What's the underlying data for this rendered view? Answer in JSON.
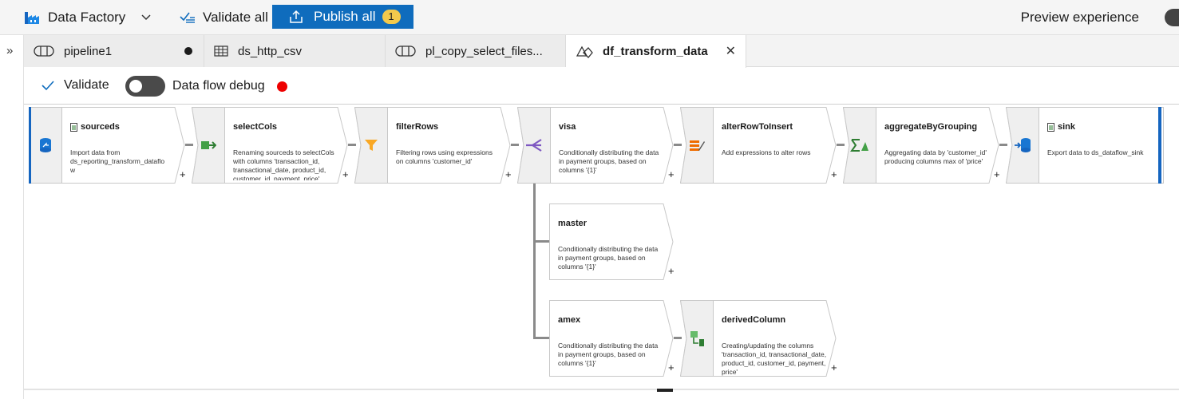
{
  "toolbar": {
    "factory_label": "Data Factory",
    "validate_all_label": "Validate all",
    "publish_label": "Publish all",
    "publish_count": "1",
    "preview_label": "Preview experience"
  },
  "tabs": [
    {
      "label": "pipeline1",
      "icon": "pipeline-icon",
      "state": "unsaved"
    },
    {
      "label": "ds_http_csv",
      "icon": "table-icon",
      "state": "normal"
    },
    {
      "label": "pl_copy_select_files...",
      "icon": "pipeline-icon",
      "state": "normal"
    },
    {
      "label": "df_transform_data",
      "icon": "dataflow-icon",
      "state": "active"
    }
  ],
  "subbar": {
    "validate_label": "Validate",
    "debug_label": "Data flow debug",
    "debug_enabled": false
  },
  "colors": {
    "accent": "#0f6cbd",
    "badge": "#f2c94c",
    "debug_dot": "#e00000",
    "source_accent": "#1565c0"
  },
  "nodes": [
    {
      "id": "sourceds",
      "title": "sourceds",
      "desc": "Import data from ds_reporting_transform_dataflo w",
      "icon": "source-icon",
      "plus": "+"
    },
    {
      "id": "selectCols",
      "title": "selectCols",
      "desc": "Renaming sourceds to selectCols with columns 'transaction_id, transactional_date, product_id, customer_id, payment, price'",
      "icon": "select-icon",
      "plus": "+"
    },
    {
      "id": "filterRows",
      "title": "filterRows",
      "desc": "Filtering rows using expressions on columns 'customer_id'",
      "icon": "filter-icon",
      "plus": "+"
    },
    {
      "id": "visa",
      "title": "visa",
      "desc": "Conditionally distributing the data in payment groups, based on columns '{1}'",
      "icon": "split-icon",
      "plus": "+"
    },
    {
      "id": "alterRowToInsert",
      "title": "alterRowToInsert",
      "desc": "Add expressions to alter rows",
      "icon": "alter-row-icon",
      "plus": "+"
    },
    {
      "id": "aggregateByGrouping",
      "title": "aggregateByGrouping",
      "desc": "Aggregating data by 'customer_id' producing columns max of 'price'",
      "icon": "aggregate-icon",
      "plus": "+"
    },
    {
      "id": "sink",
      "title": "sink",
      "desc": "Export data to ds_dataflow_sink",
      "icon": "sink-icon",
      "plus": ""
    },
    {
      "id": "master",
      "title": "master",
      "desc": "Conditionally distributing the data in payment groups, based on columns '{1}'",
      "icon": "",
      "plus": "+"
    },
    {
      "id": "amex",
      "title": "amex",
      "desc": "Conditionally distributing the data in payment groups, based on columns '{1}'",
      "icon": "",
      "plus": "+"
    },
    {
      "id": "derivedColumn",
      "title": "derivedColumn",
      "desc": "Creating/updating the columns 'transaction_id, transactional_date, product_id, customer_id, payment, price'",
      "icon": "derived-column-icon",
      "plus": "+"
    }
  ]
}
